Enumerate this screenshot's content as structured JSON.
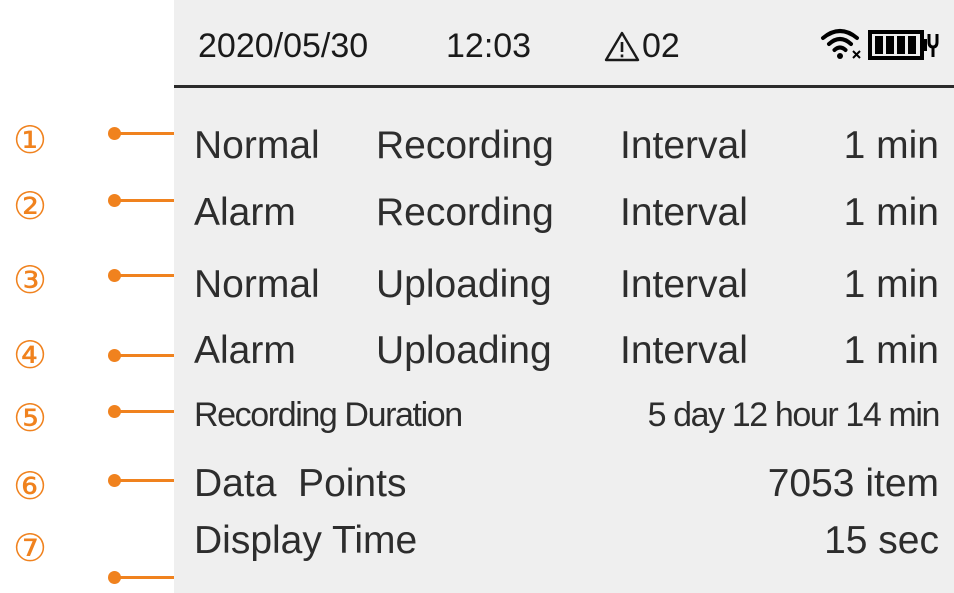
{
  "status_bar": {
    "date": "2020/05/30",
    "time": "12:03",
    "alarm_count": "02",
    "wifi_icon": "wifi-disconnected-icon",
    "battery_icon": "battery-charging-icon"
  },
  "settings": [
    {
      "marker": "①",
      "w1": "Normal",
      "w2": "Recording",
      "w3": "Interval",
      "value": "1 min"
    },
    {
      "marker": "②",
      "w1": "Alarm",
      "w2": "Recording",
      "w3": "Interval",
      "value": "1 min"
    },
    {
      "marker": "③",
      "w1": "Normal",
      "w2": "Uploading",
      "w3": "Interval",
      "value": "1 min"
    },
    {
      "marker": "④",
      "w1": "Alarm",
      "w2": "Uploading",
      "w3": "Interval",
      "value": "1 min"
    },
    {
      "marker": "⑤",
      "label": "Recording Duration",
      "value": "5 day 12 hour 14 min"
    },
    {
      "marker": "⑥",
      "label": "Data  Points",
      "value": "7053 item"
    },
    {
      "marker": "⑦",
      "label": "Display Time",
      "value": "15 sec"
    }
  ],
  "colors": {
    "accent": "#f0821e",
    "screen_bg": "#efefef",
    "text": "#2d2d2d"
  }
}
